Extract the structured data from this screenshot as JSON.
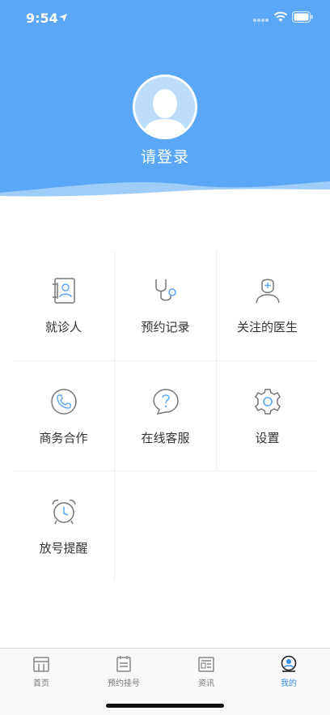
{
  "status_bar": {
    "time": "9:54"
  },
  "profile": {
    "login_prompt": "请登录"
  },
  "menu": {
    "items": [
      {
        "label": "就诊人",
        "icon": "patient-contact-icon"
      },
      {
        "label": "预约记录",
        "icon": "stethoscope-icon"
      },
      {
        "label": "关注的医生",
        "icon": "doctor-icon"
      },
      {
        "label": "商务合作",
        "icon": "phone-icon"
      },
      {
        "label": "在线客服",
        "icon": "chat-help-icon"
      },
      {
        "label": "设置",
        "icon": "gear-icon"
      },
      {
        "label": "放号提醒",
        "icon": "alarm-clock-icon"
      }
    ]
  },
  "tabbar": {
    "items": [
      {
        "label": "首页",
        "icon": "home-calendar-icon"
      },
      {
        "label": "预约挂号",
        "icon": "appointment-icon"
      },
      {
        "label": "资讯",
        "icon": "news-icon"
      },
      {
        "label": "我的",
        "icon": "profile-icon"
      }
    ],
    "active_index": 3
  },
  "colors": {
    "header": "#5aa8f5",
    "active_tab": "#3a8ee6",
    "icon_accent": "#5aa8f5",
    "icon_gray": "#777777"
  }
}
